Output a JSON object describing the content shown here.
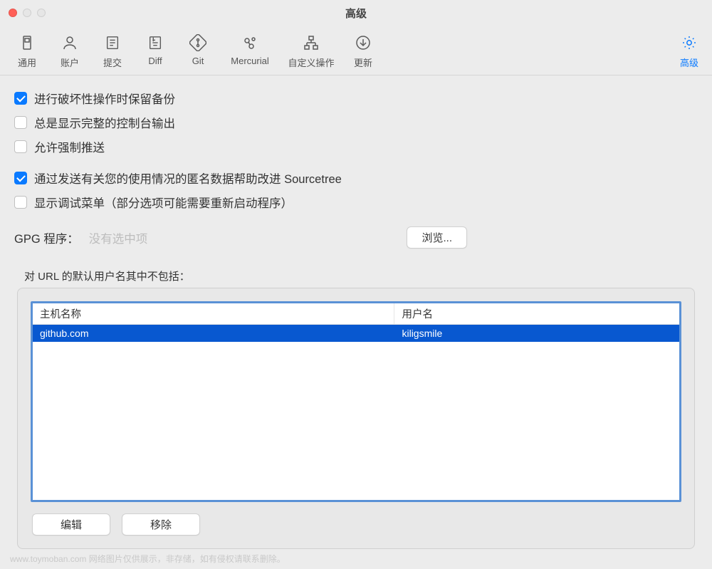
{
  "window": {
    "title": "高级"
  },
  "toolbar": {
    "items": [
      {
        "label": "通用"
      },
      {
        "label": "账户"
      },
      {
        "label": "提交"
      },
      {
        "label": "Diff"
      },
      {
        "label": "Git"
      },
      {
        "label": "Mercurial"
      },
      {
        "label": "自定义操作"
      },
      {
        "label": "更新"
      }
    ],
    "active": {
      "label": "高级"
    }
  },
  "checks": {
    "keep_backup": "进行破坏性操作时保留备份",
    "full_console": "总是显示完整的控制台输出",
    "force_push": "允许强制推送",
    "anon_data": "通过发送有关您的使用情况的匿名数据帮助改进 Sourcetree",
    "debug_menu": "显示调试菜单（部分选项可能需要重新启动程序）"
  },
  "gpg": {
    "label": "GPG 程序：",
    "placeholder": "没有选中项",
    "browse": "浏览..."
  },
  "defaults": {
    "label": "对 URL 的默认用户名其中不包括：",
    "columns": {
      "host": "主机名称",
      "user": "用户名"
    },
    "rows": [
      {
        "host": "github.com",
        "user": "kiligsmile"
      }
    ],
    "edit": "编辑",
    "remove": "移除"
  },
  "watermark": "www.toymoban.com 网络图片仅供展示，非存储，如有侵权请联系删除。"
}
